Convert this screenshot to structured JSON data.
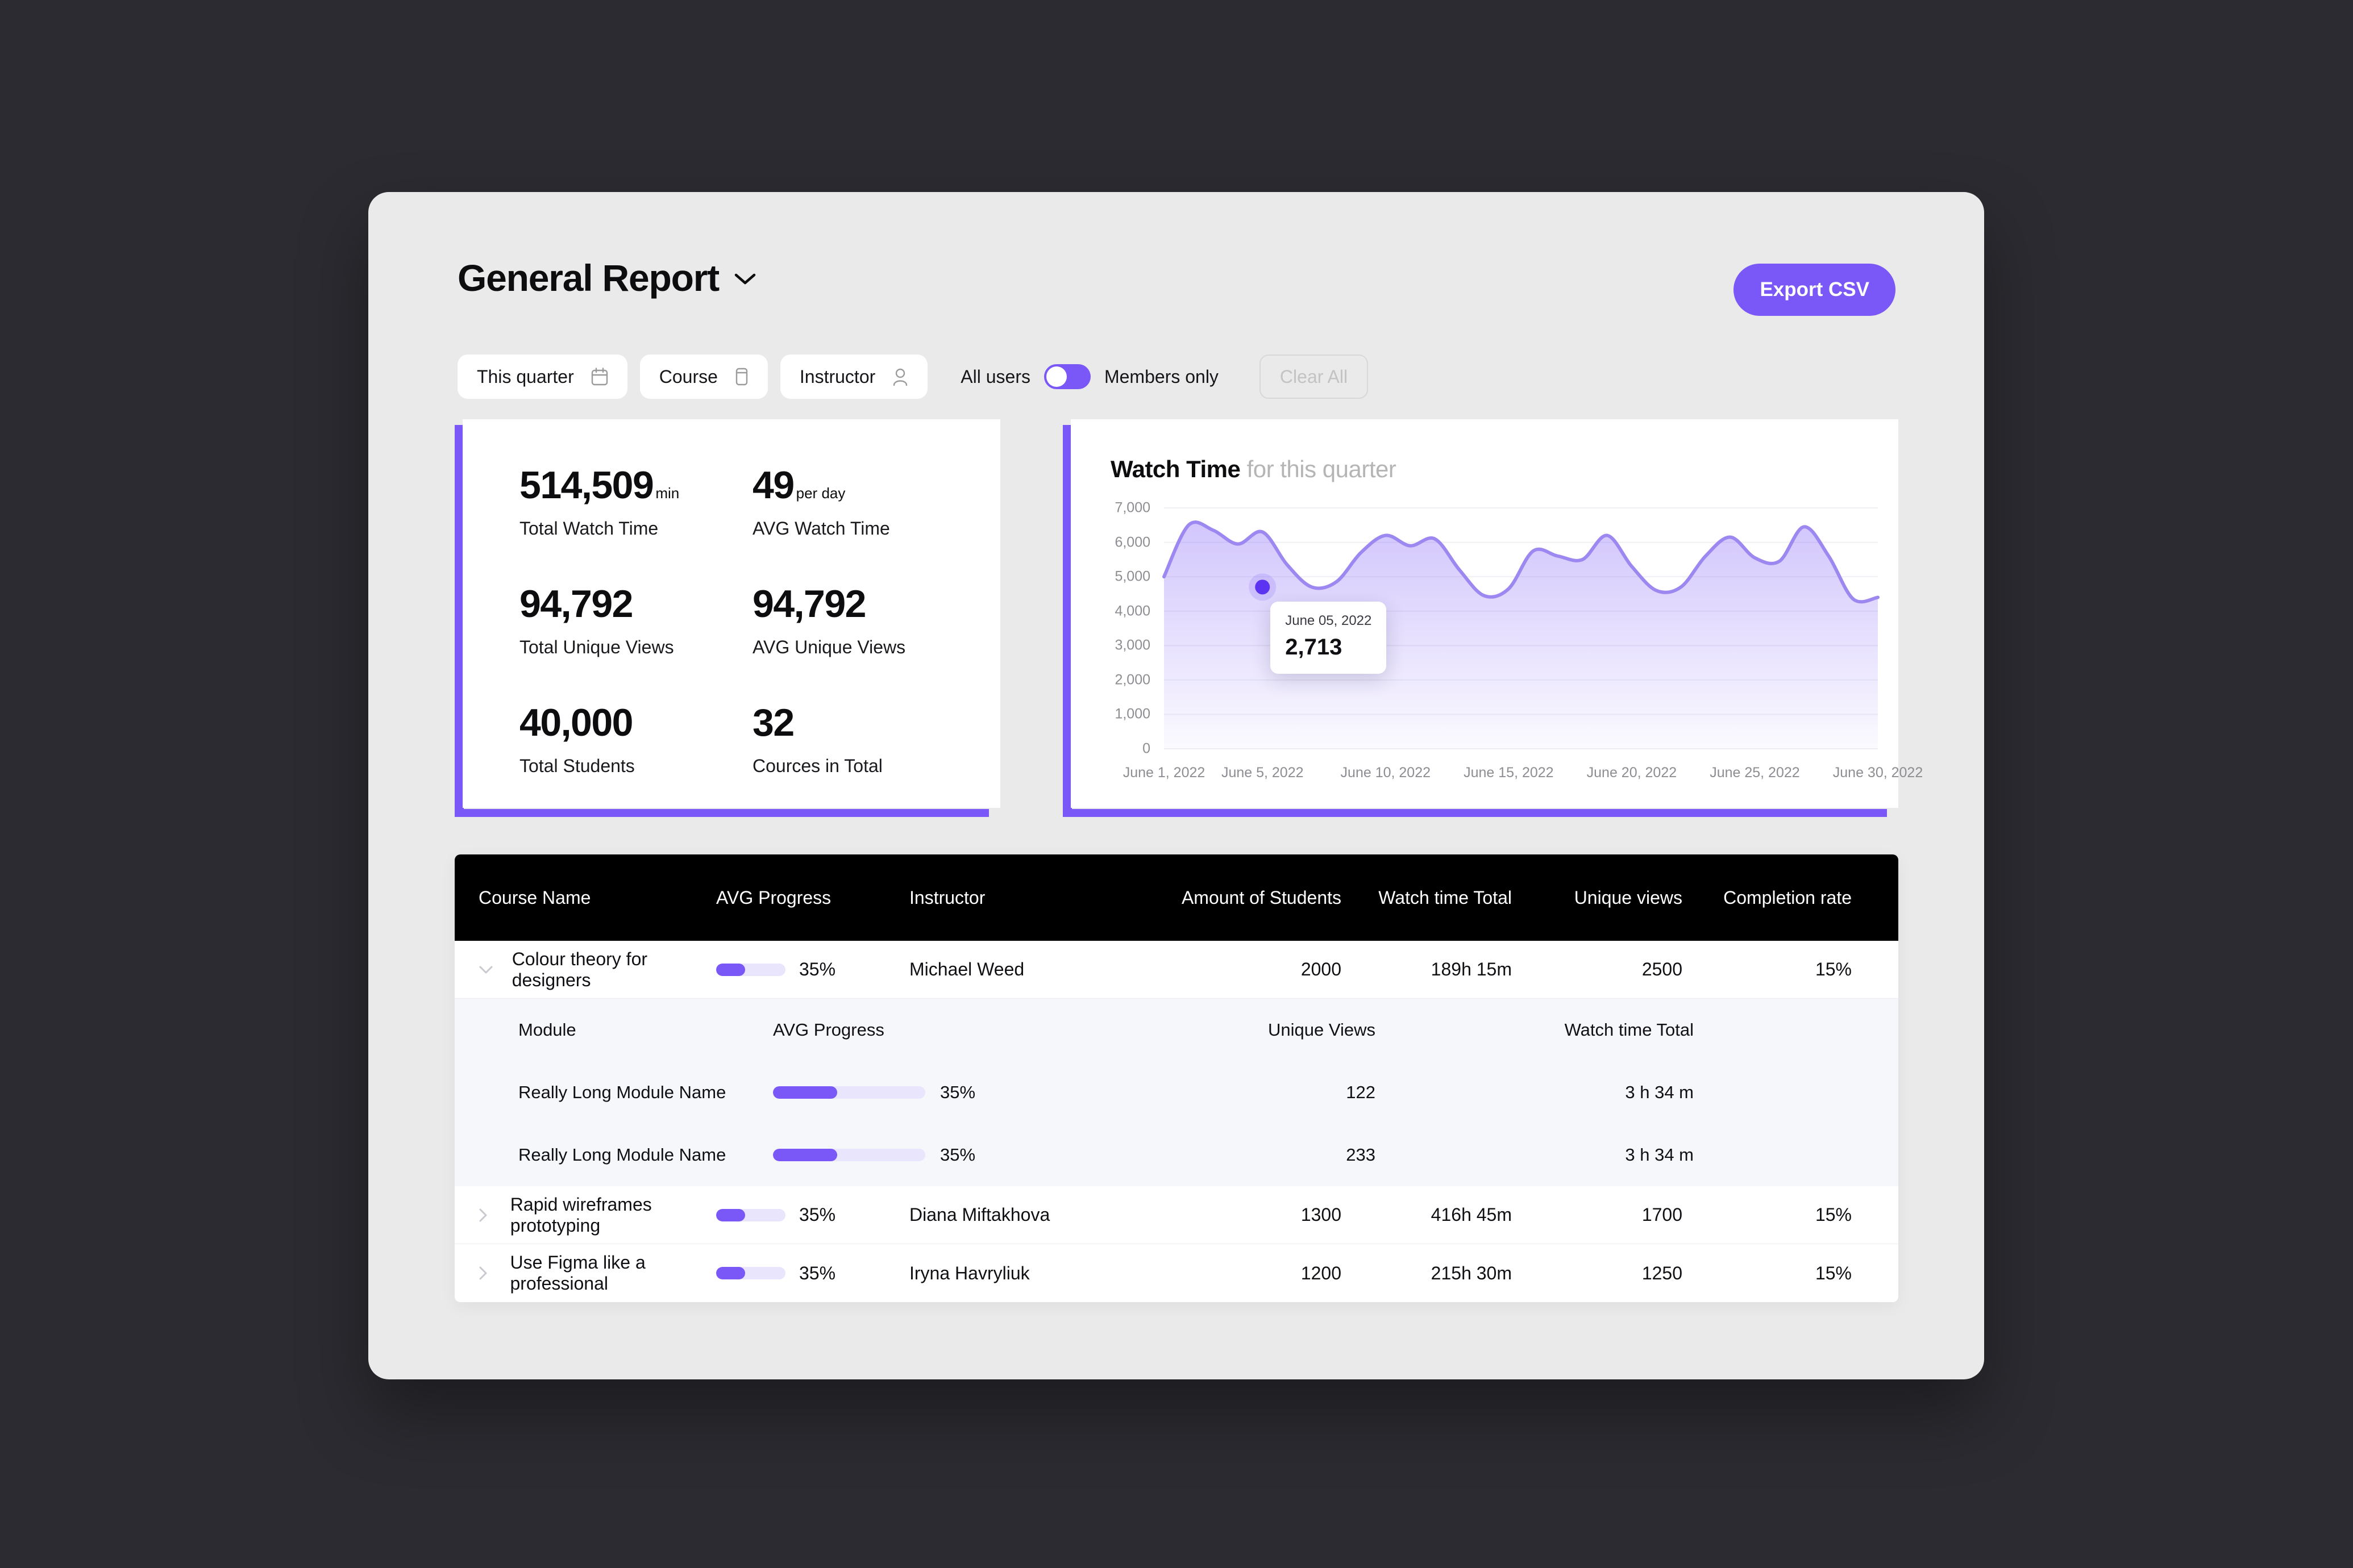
{
  "header": {
    "title": "General Report",
    "chevron_icon": "chevron-down-icon",
    "export_label": "Export CSV"
  },
  "filters": {
    "pills": [
      {
        "label": "This quarter",
        "icon": "calendar-icon"
      },
      {
        "label": "Course",
        "icon": "book-icon"
      },
      {
        "label": "Instructor",
        "icon": "person-icon"
      }
    ],
    "toggle_left_label": "All users",
    "toggle_right_label": "Members only",
    "toggle_state": "on",
    "clear_all_label": "Clear All"
  },
  "stats": [
    {
      "value": "514,509",
      "unit": "min",
      "label": "Total Watch Time"
    },
    {
      "value": "49",
      "unit": "per day",
      "label": "AVG Watch Time"
    },
    {
      "value": "94,792",
      "unit": "",
      "label": "Total Unique Views"
    },
    {
      "value": "94,792",
      "unit": "",
      "label": "AVG Unique Views"
    },
    {
      "value": "40,000",
      "unit": "",
      "label": "Total Students"
    },
    {
      "value": "32",
      "unit": "",
      "label": "Cources in Total"
    }
  ],
  "chart_card": {
    "title_strong": "Watch Time",
    "title_muted": "for this quarter",
    "tooltip": {
      "date": "June 05, 2022",
      "value": "2,713"
    }
  },
  "chart_data": {
    "type": "area",
    "title": "Watch Time for this quarter",
    "xlabel": "",
    "ylabel": "",
    "ylim": [
      0,
      7000
    ],
    "grid": true,
    "legend": "none",
    "line_color": "#9d87f0",
    "fill_color": "#7a57f7",
    "y_ticks": [
      "7,000",
      "6,000",
      "5,000",
      "4,000",
      "3,000",
      "2,000",
      "1,000",
      "0"
    ],
    "x_ticks": [
      "June 1, 2022",
      "June 5, 2022",
      "June 10, 2022",
      "June 15, 2022",
      "June 20, 2022",
      "June 25, 2022",
      "June 30, 2022"
    ],
    "x": [
      1,
      2,
      3,
      4,
      5,
      6,
      7,
      8,
      9,
      10,
      11,
      12,
      13,
      14,
      15,
      16,
      17,
      18,
      19,
      20,
      21,
      22,
      23,
      24,
      25,
      26,
      27,
      28,
      29,
      30
    ],
    "values": [
      5000,
      6500,
      6350,
      5950,
      6300,
      5350,
      4700,
      4850,
      5700,
      6200,
      5900,
      6100,
      5200,
      4450,
      4650,
      5750,
      5600,
      5500,
      6200,
      5300,
      4600,
      4700,
      5600,
      6150,
      5550,
      5450,
      6450,
      5600,
      4350,
      4400
    ],
    "highlight": {
      "x_label": "June 05, 2022",
      "value": 2713,
      "plot_y_value": 4700
    }
  },
  "table": {
    "columns": [
      "Course Name",
      "AVG Progress",
      "Instructor",
      "Amount of Students",
      "Watch time Total",
      "Unique views",
      "Completion rate"
    ],
    "rows": [
      {
        "expanded": true,
        "chevron_icon": "chevron-down-icon",
        "name": "Colour theory for designers",
        "progress": "35%",
        "progress_pct": 42,
        "instructor": "Michael Weed",
        "students": "2000",
        "watch_time": "189h 15m",
        "unique_views": "2500",
        "completion": "15%"
      },
      {
        "expanded": false,
        "chevron_icon": "chevron-right-icon",
        "name": "Rapid wireframes prototyping",
        "progress": "35%",
        "progress_pct": 42,
        "instructor": "Diana Miftakhova",
        "students": "1300",
        "watch_time": "416h 45m",
        "unique_views": "1700",
        "completion": "15%"
      },
      {
        "expanded": false,
        "chevron_icon": "chevron-right-icon",
        "name": "Use Figma like a professional",
        "progress": "35%",
        "progress_pct": 42,
        "instructor": "Iryna Havryliuk",
        "students": "1200",
        "watch_time": "215h 30m",
        "unique_views": "1250",
        "completion": "15%"
      }
    ],
    "subtable": {
      "columns": [
        "Module",
        "AVG Progress",
        "Unique Views",
        "Watch time Total"
      ],
      "rows": [
        {
          "module": "Really Long Module Name",
          "progress": "35%",
          "progress_pct": 42,
          "unique_views": "122",
          "watch_time": "3 h 34 m"
        },
        {
          "module": "Really Long Module Name",
          "progress": "35%",
          "progress_pct": 42,
          "unique_views": "233",
          "watch_time": "3 h 34 m"
        }
      ]
    }
  },
  "colors": {
    "accent": "#7a57f7",
    "panel": "#eaeaea",
    "backdrop": "#2b2b31",
    "progress_track": "#e9e5fd",
    "subtable_bg": "#f6f7fb"
  }
}
